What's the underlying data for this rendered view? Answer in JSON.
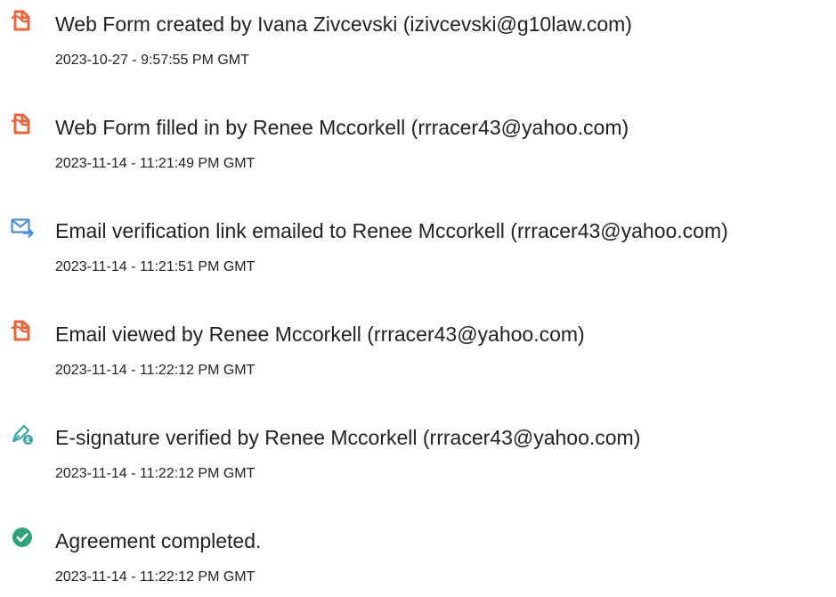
{
  "events": [
    {
      "icon": "document-pdf-icon",
      "title": "Web Form created by Ivana Zivcevski (izivcevski@g10law.com)",
      "timestamp": "2023-10-27 - 9:57:55 PM GMT"
    },
    {
      "icon": "document-pdf-icon",
      "title": "Web Form filled in by Renee Mccorkell (rrracer43@yahoo.com)",
      "timestamp": "2023-11-14 - 11:21:49 PM GMT"
    },
    {
      "icon": "email-sent-icon",
      "title": "Email verification link emailed to Renee Mccorkell (rrracer43@yahoo.com)",
      "timestamp": "2023-11-14 - 11:21:51 PM GMT"
    },
    {
      "icon": "document-pdf-icon",
      "title": "Email viewed by Renee Mccorkell (rrracer43@yahoo.com)",
      "timestamp": "2023-11-14 - 11:22:12 PM GMT"
    },
    {
      "icon": "esignature-verified-icon",
      "title": "E-signature verified by Renee Mccorkell (rrracer43@yahoo.com)",
      "timestamp": "2023-11-14 - 11:22:12 PM GMT"
    },
    {
      "icon": "check-circle-icon",
      "title": "Agreement completed.",
      "timestamp": "2023-11-14 - 11:22:12 PM GMT"
    }
  ],
  "colors": {
    "pdf_icon": "#E8643C",
    "email_icon": "#4A90D9",
    "signature_icon": "#3BA3A8",
    "check_icon": "#2FA37A",
    "text": "#222222"
  }
}
